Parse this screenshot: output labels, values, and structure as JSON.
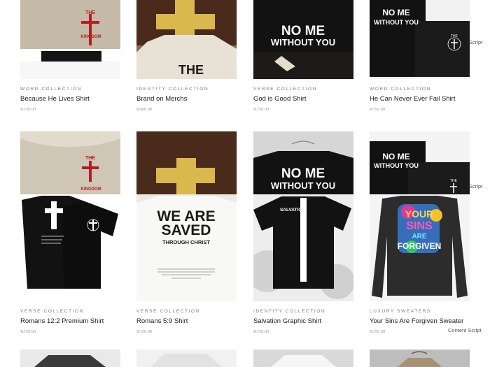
{
  "products_row1": [
    {
      "collection": "WORD COLLECTION",
      "title": "Because He Lives Shirt",
      "price": "R350.00"
    },
    {
      "collection": "IDENTITY COLLECTION",
      "title": "Brand on Merchs",
      "price": "R400.00"
    },
    {
      "collection": "VERSE COLLECTION",
      "title": "God is Good Shirt",
      "price": "R350.00"
    },
    {
      "collection": "WORD COLLECTION",
      "title": "He Can Never Ever Fail Shirt",
      "price": "R350.00"
    }
  ],
  "products_row2": [
    {
      "collection": "VERSE COLLECTION",
      "title": "Romans 12:2 Premium Shirt",
      "price": "R350.00"
    },
    {
      "collection": "VERSE COLLECTION",
      "title": "Romans 5:9 Shirt",
      "price": "R350.00"
    },
    {
      "collection": "IDENTITY COLLECTION",
      "title": "Salvation Graphic Shirt",
      "price": "R350.00"
    },
    {
      "collection": "LUXURY SWEATERS",
      "title": "Your Sins Are Forgiven Sweater",
      "price": "R350.00"
    }
  ],
  "image_text": {
    "the_kingdom_line1": "THE",
    "the_kingdom_line2": "KINGDOM",
    "no_me_line1": "NO ME",
    "no_me_line2": "WITHOUT YOU",
    "the_bag": "THE",
    "we_are_saved_line1": "WE ARE",
    "we_are_saved_line2": "SAVED",
    "through_christ": "THROUGH CHRIST",
    "salvation": "SALVATION",
    "your_sins_line1": "YOUR",
    "your_sins_line2": "SINS",
    "your_sins_line3": "ARE",
    "your_sins_line4": "FORGIVEN"
  },
  "overlay_labels": {
    "script_1": "Script",
    "script_2": "Script",
    "content_script": "Content Script"
  },
  "colors": {
    "kingdom_red": "#b41e24",
    "mustard": "#d9b84e",
    "brown_tee": "#4a2a1a",
    "black_tee": "#141414",
    "sweater": "#c9bfae"
  }
}
